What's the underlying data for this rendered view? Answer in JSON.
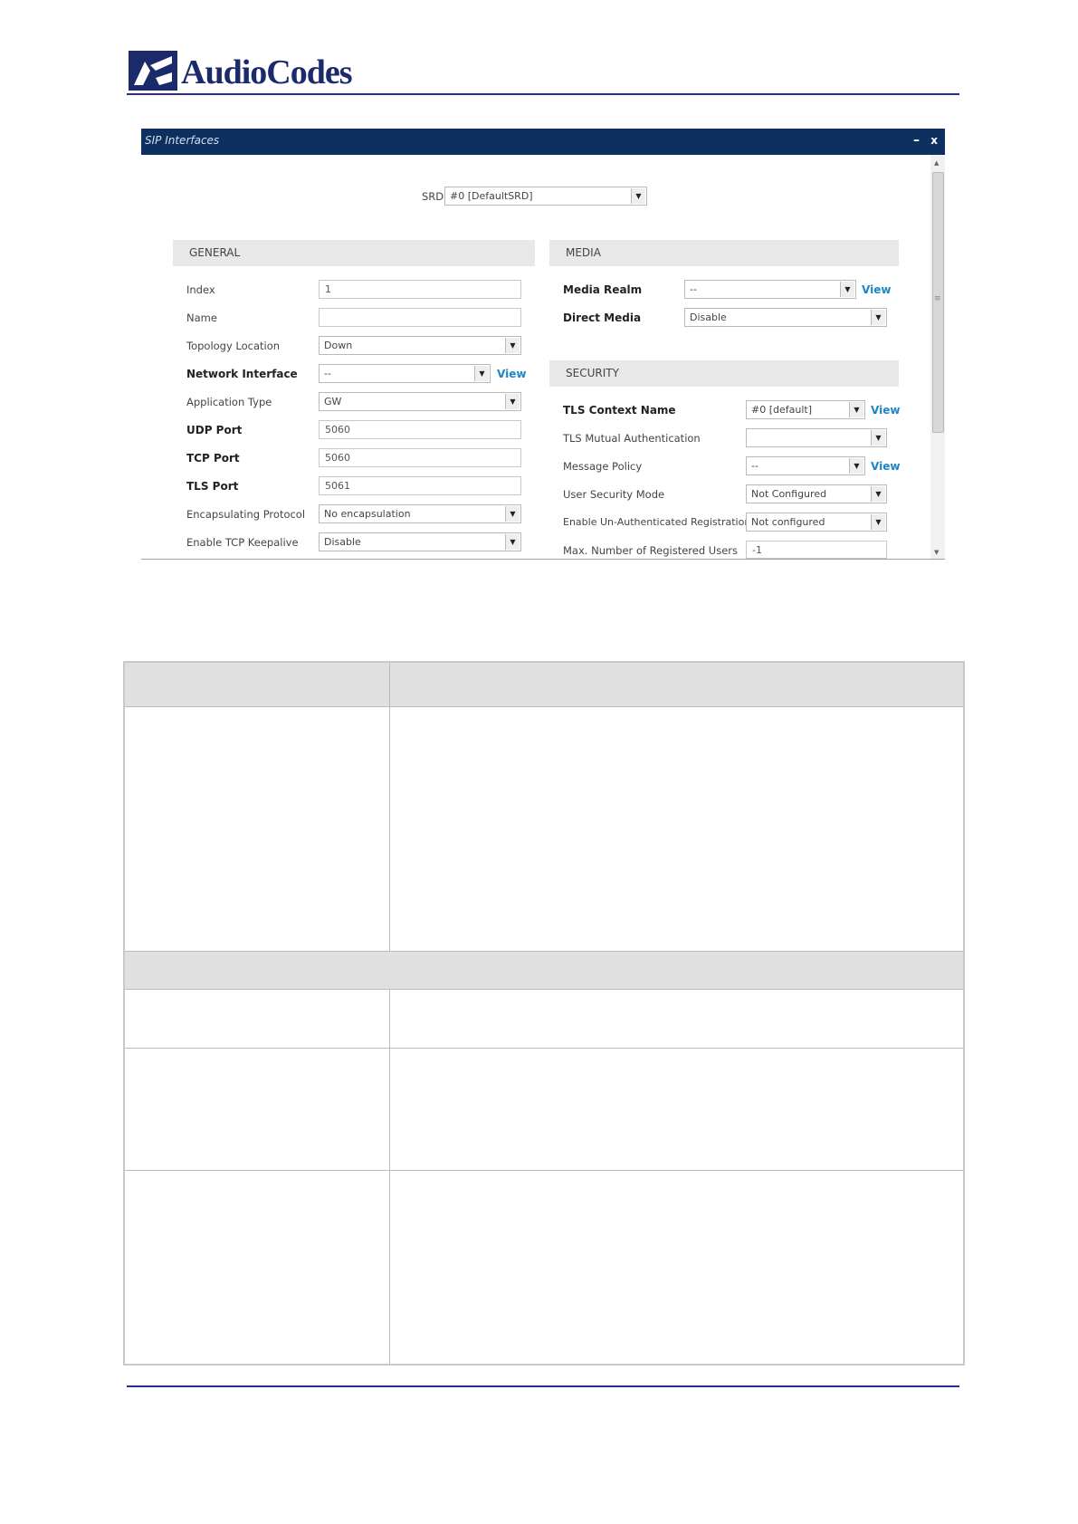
{
  "header": {
    "brand": "AudioCodes"
  },
  "dialog": {
    "title": "SIP Interfaces",
    "minimize": "–",
    "close": "x",
    "srd": {
      "label": "SRD",
      "value": "#0 [DefaultSRD]"
    },
    "general": {
      "title": "GENERAL",
      "index": {
        "label": "Index",
        "value": "1"
      },
      "name": {
        "label": "Name",
        "value": ""
      },
      "topology": {
        "label": "Topology Location",
        "value": "Down"
      },
      "network_interface": {
        "label": "Network Interface",
        "value": "--",
        "view": "View"
      },
      "application_type": {
        "label": "Application Type",
        "value": "GW"
      },
      "udp_port": {
        "label": "UDP Port",
        "value": "5060"
      },
      "tcp_port": {
        "label": "TCP Port",
        "value": "5060"
      },
      "tls_port": {
        "label": "TLS Port",
        "value": "5061"
      },
      "encapsulating": {
        "label": "Encapsulating Protocol",
        "value": "No encapsulation"
      },
      "tcp_keepalive": {
        "label": "Enable TCP Keepalive",
        "value": "Disable"
      }
    },
    "media": {
      "title": "MEDIA",
      "realm": {
        "label": "Media Realm",
        "value": "--",
        "view": "View"
      },
      "direct": {
        "label": "Direct Media",
        "value": "Disable"
      }
    },
    "security": {
      "title": "SECURITY",
      "tls_context": {
        "label": "TLS Context Name",
        "value": "#0 [default]",
        "view": "View"
      },
      "tls_mutual": {
        "label": "TLS Mutual Authentication",
        "value": ""
      },
      "message_policy": {
        "label": "Message Policy",
        "value": "--",
        "view": "View"
      },
      "user_security": {
        "label": "User Security Mode",
        "value": "Not Configured"
      },
      "unauth_reg": {
        "label": "Enable Un-Authenticated Registrations",
        "value": "Not configured"
      },
      "max_users": {
        "label": "Max. Number of Registered Users",
        "value": "-1"
      }
    }
  }
}
